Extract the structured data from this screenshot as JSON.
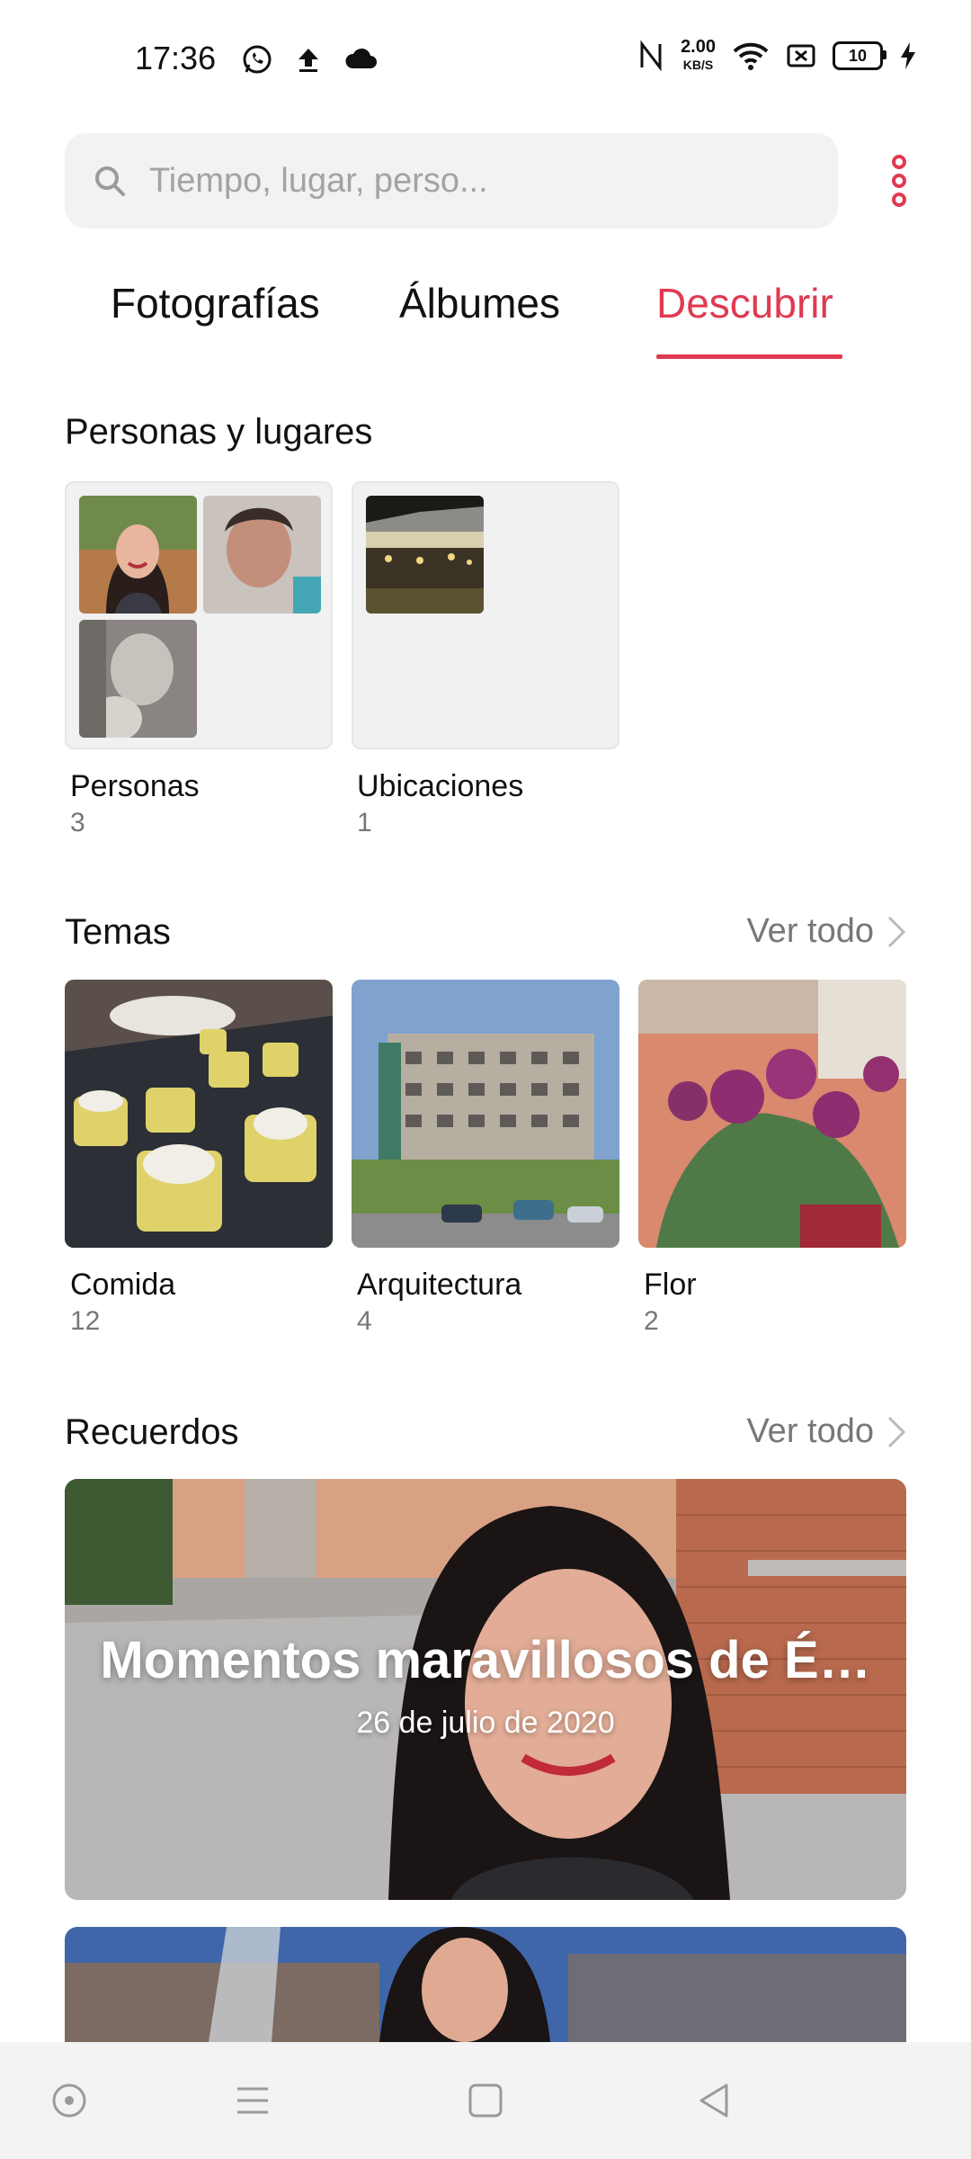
{
  "status_bar": {
    "time": "17:36",
    "net_speed_value": "2.00",
    "net_speed_unit": "KB/S",
    "battery_level": "10",
    "left_icons": [
      "whatsapp-icon",
      "upload-icon",
      "cloud-icon"
    ],
    "right_icons": [
      "nfc-icon",
      "wifi-icon",
      "sim-off-icon",
      "battery-icon",
      "charging-icon"
    ]
  },
  "search": {
    "placeholder": "Tiempo, lugar, perso..."
  },
  "tabs": [
    {
      "label": "Fotografías",
      "active": false
    },
    {
      "label": "Álbumes",
      "active": false
    },
    {
      "label": "Descubrir",
      "active": true
    }
  ],
  "people_places": {
    "title": "Personas y lugares",
    "items": [
      {
        "label": "Personas",
        "count": "3"
      },
      {
        "label": "Ubicaciones",
        "count": "1"
      }
    ]
  },
  "themes": {
    "title": "Temas",
    "see_all": "Ver todo",
    "items": [
      {
        "label": "Comida",
        "count": "12"
      },
      {
        "label": "Arquitectura",
        "count": "4"
      },
      {
        "label": "Flor",
        "count": "2"
      }
    ]
  },
  "memories": {
    "title": "Recuerdos",
    "see_all": "Ver todo",
    "cards": [
      {
        "title": "Momentos maravillosos de É…",
        "date": "26 de julio de 2020"
      }
    ]
  },
  "colors": {
    "accent": "#e03a52",
    "search_bg": "#f2f2f2",
    "muted_text": "#777777"
  }
}
